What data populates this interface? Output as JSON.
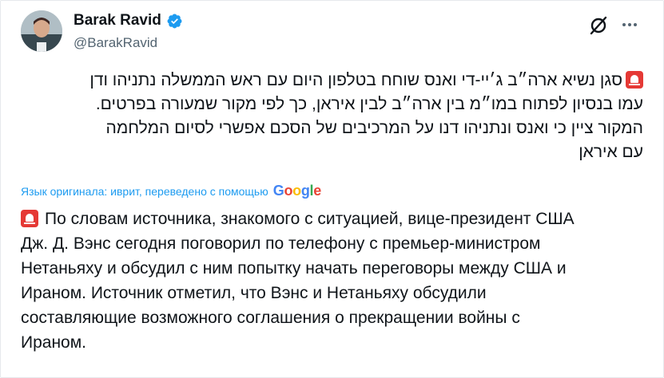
{
  "author": {
    "name": "Barak Ravid",
    "handle": "@BarakRavid"
  },
  "icons": {
    "verified": "verified-badge-icon",
    "grok": "grok-icon",
    "more": "more-options-icon",
    "siren": "rotating-light-emoji"
  },
  "colors": {
    "verified": "#1d9bf0",
    "translate_link": "#1d9bf0",
    "siren": "#e53935"
  },
  "tweet": {
    "hebrew_lines": [
      "סגן נשיא ארה״ב ג׳יי-די ואנס שוחח בטלפון היום עם ראש הממשלה נתניהו ודן",
      "עמו בנסיון לפתוח במו״מ בין ארה״ב לבין איראן, כך לפי מקור שמעורה בפרטים.",
      "המקור ציין כי ואנס ונתניהו דנו על המרכיבים של הסכם אפשרי לסיום המלחמה",
      "עם איראן"
    ],
    "translation_note": "Язык оригинала: иврит, переведено с помощью",
    "google_logo": [
      "G",
      "o",
      "o",
      "g",
      "l",
      "e"
    ],
    "russian_lines": [
      "По словам источника, знакомого с ситуацией, вице-президент США",
      "Дж. Д. Вэнс сегодня поговорил по телефону с премьер-министром",
      "Нетаньяху и обсудил с ним попытку начать переговоры между США и",
      "Ираном. Источник отметил, что Вэнс и Нетаньяху обсудили",
      "составляющие возможного соглашения о прекращении войны с",
      "Ираном."
    ]
  }
}
